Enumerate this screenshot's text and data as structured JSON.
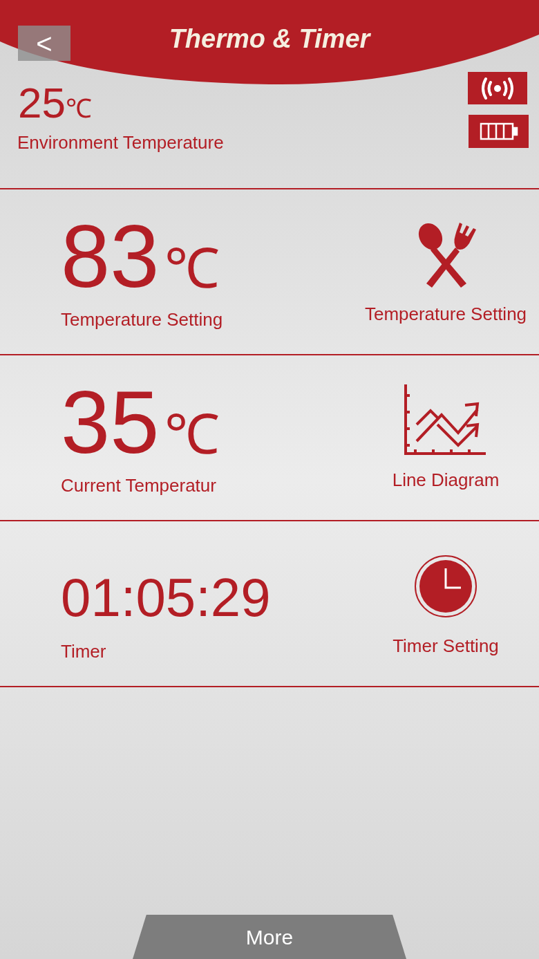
{
  "header": {
    "back": "<",
    "title": "Thermo & Timer"
  },
  "environment": {
    "value": "25",
    "unit": "℃",
    "label": "Environment Temperature"
  },
  "rows": [
    {
      "kind": "utensils",
      "value": "83",
      "unit": "℃",
      "label": "Temperature Setting",
      "action": "Temperature Setting"
    },
    {
      "kind": "chart",
      "value": "35",
      "unit": "℃",
      "label": "Current Temperatur",
      "action": "Line Diagram"
    },
    {
      "kind": "clock",
      "value": "01:05:29",
      "label": "Timer",
      "action": "Timer Setting"
    }
  ],
  "more": "More"
}
